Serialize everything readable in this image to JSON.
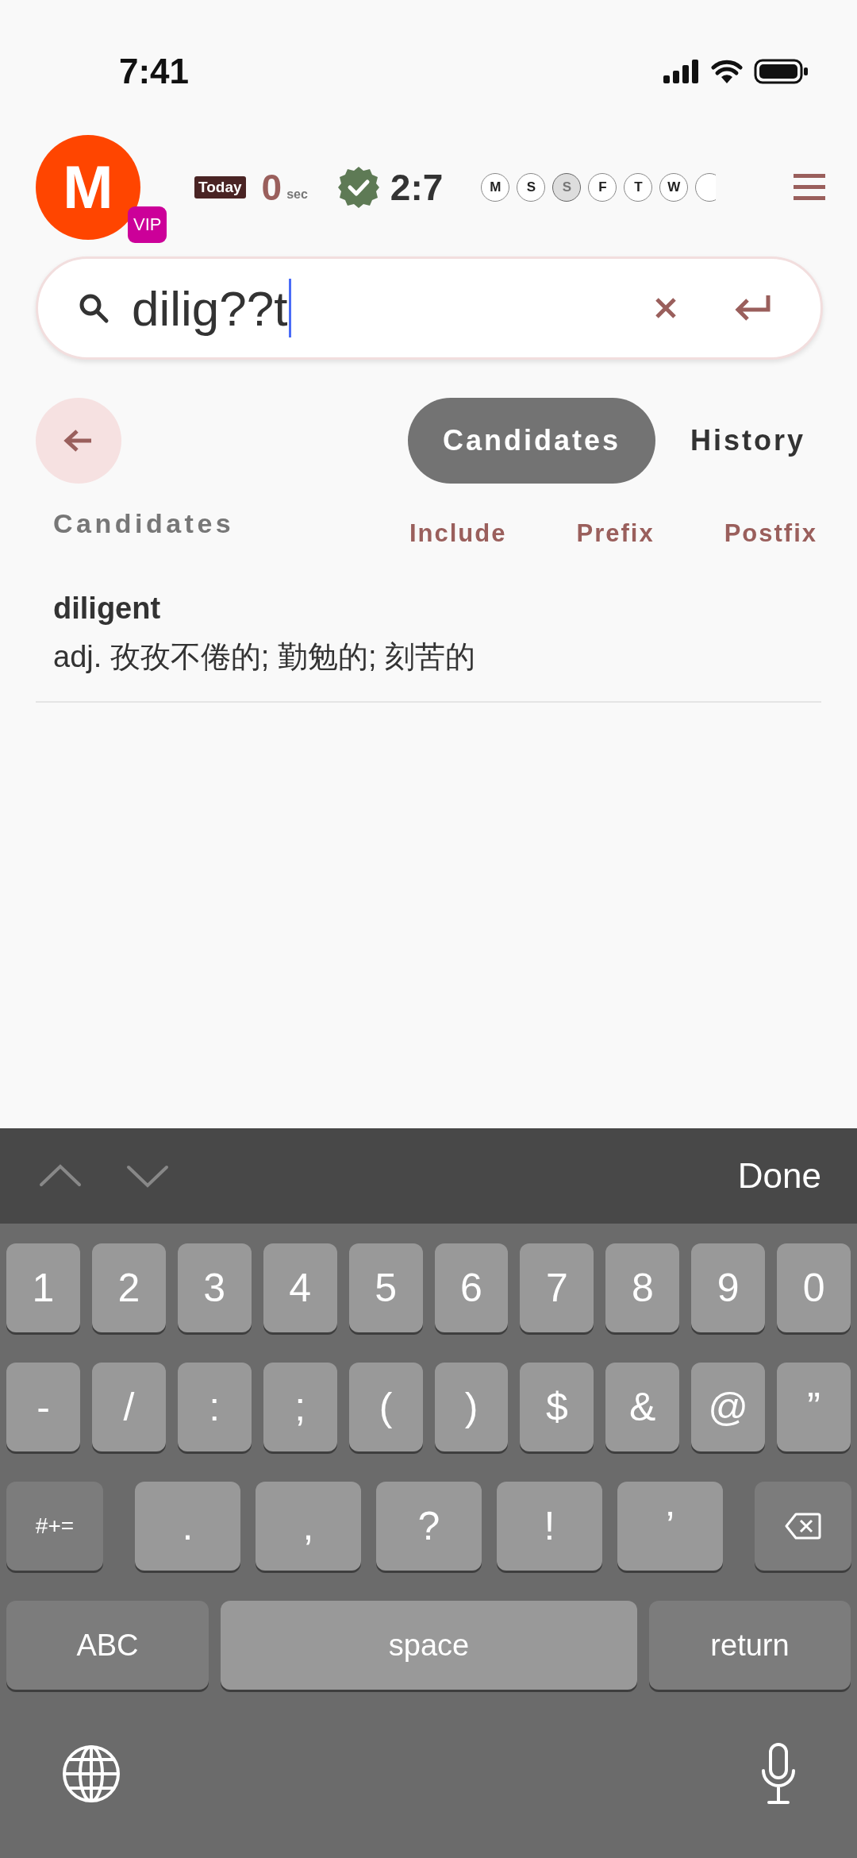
{
  "status_bar": {
    "time": "7:41"
  },
  "header": {
    "avatar_letter": "M",
    "badge": "VIP",
    "today_label": "Today",
    "today_value": "0",
    "today_unit": "sec",
    "score": "2:7",
    "days": [
      {
        "label": "M",
        "selected": false
      },
      {
        "label": "S",
        "selected": false
      },
      {
        "label": "S",
        "selected": true
      },
      {
        "label": "F",
        "selected": false
      },
      {
        "label": "T",
        "selected": false
      },
      {
        "label": "W",
        "selected": false
      }
    ]
  },
  "search": {
    "value": "dilig??t"
  },
  "tabs": [
    {
      "label": "Candidates",
      "selected": true
    },
    {
      "label": "History",
      "selected": false
    }
  ],
  "section_title": "Candidates",
  "filters": [
    "Include",
    "Prefix",
    "Postfix"
  ],
  "results": [
    {
      "word": "diligent",
      "definition": "adj. 孜孜不倦的; 勤勉的; 刻苦的"
    }
  ],
  "keyboard": {
    "done": "Done",
    "digit_keys": [
      {
        "kind": "char",
        "label": "1"
      },
      {
        "kind": "char",
        "label": "2"
      },
      {
        "kind": "char",
        "label": "3"
      },
      {
        "kind": "char",
        "label": "4"
      },
      {
        "kind": "char",
        "label": "5"
      },
      {
        "kind": "char",
        "label": "6"
      },
      {
        "kind": "char",
        "label": "7"
      },
      {
        "kind": "char",
        "label": "8"
      },
      {
        "kind": "char",
        "label": "9"
      },
      {
        "kind": "char",
        "label": "0"
      }
    ],
    "symbol_keys": [
      {
        "kind": "char",
        "label": "-"
      },
      {
        "kind": "char",
        "label": "/"
      },
      {
        "kind": "char",
        "label": ":"
      },
      {
        "kind": "char",
        "label": ";"
      },
      {
        "kind": "char",
        "label": "("
      },
      {
        "kind": "char",
        "label": ")"
      },
      {
        "kind": "char",
        "label": "$"
      },
      {
        "kind": "char",
        "label": "&"
      },
      {
        "kind": "char",
        "label": "@"
      },
      {
        "kind": "char",
        "label": "”"
      }
    ],
    "punctuation_keys": [
      {
        "kind": "mode",
        "label": "#+="
      },
      {
        "kind": "char",
        "label": "."
      },
      {
        "kind": "char",
        "label": ","
      },
      {
        "kind": "char",
        "label": "?"
      },
      {
        "kind": "char",
        "label": "!"
      },
      {
        "kind": "char",
        "label": "’"
      },
      {
        "kind": "delete"
      }
    ],
    "bottom_keys": [
      {
        "kind": "mode",
        "label": "ABC"
      },
      {
        "kind": "space",
        "label": "space"
      },
      {
        "kind": "return",
        "label": "return"
      }
    ]
  }
}
